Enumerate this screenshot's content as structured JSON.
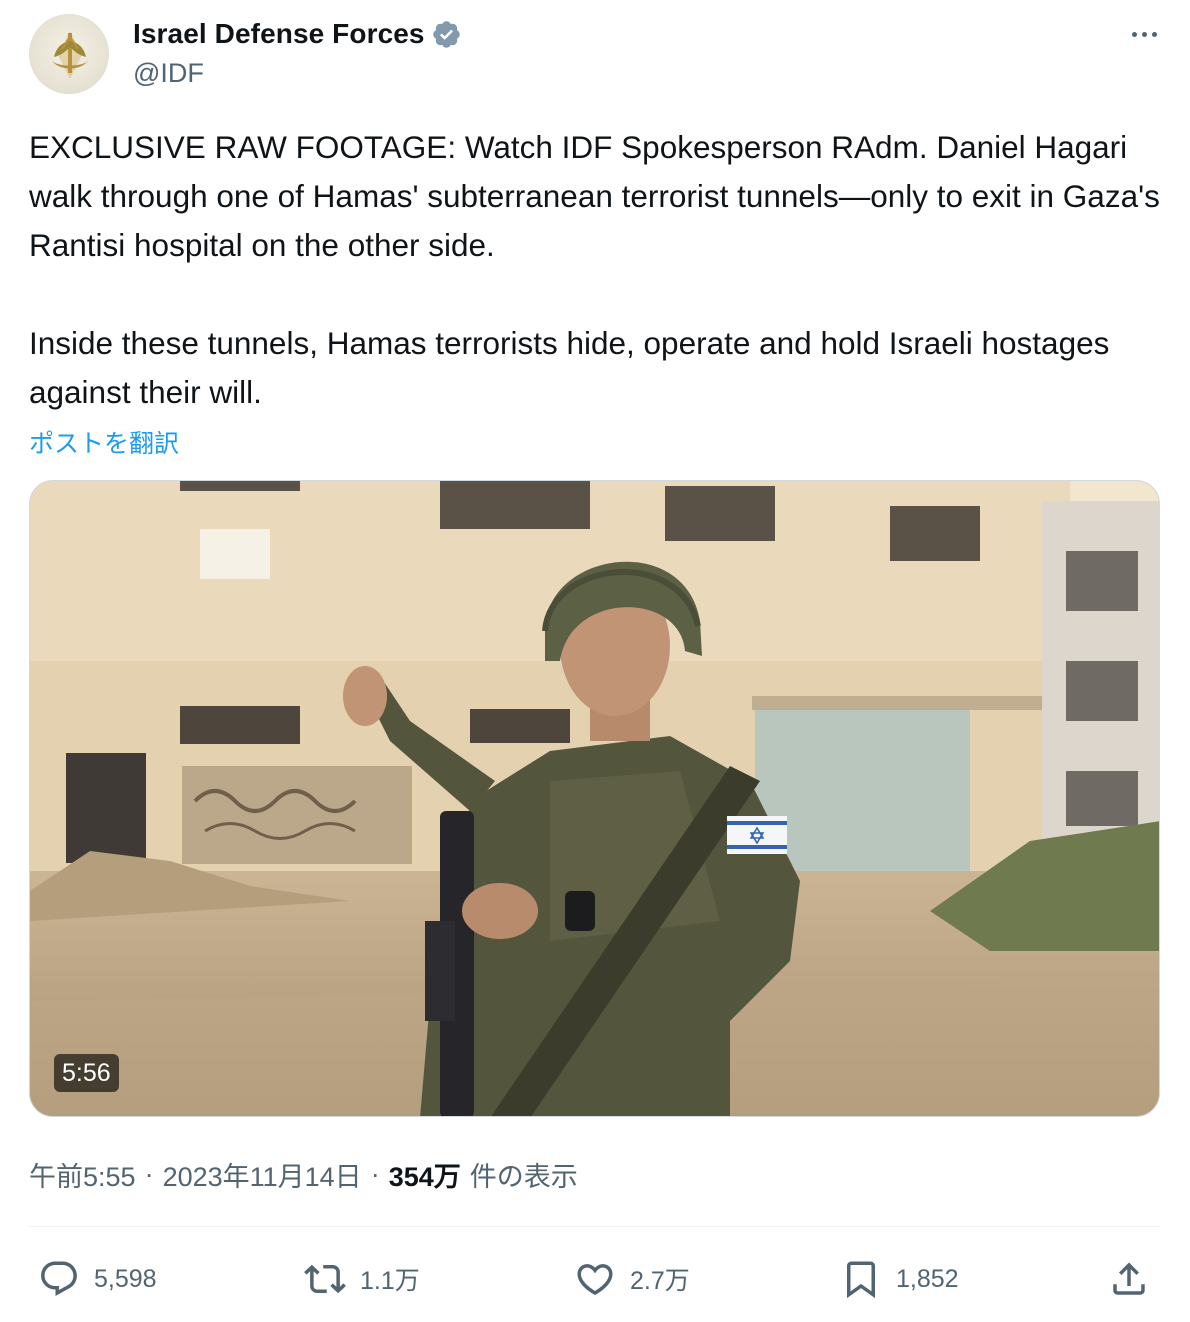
{
  "author": {
    "display_name": "Israel Defense Forces",
    "handle": "@IDF",
    "verified": true,
    "avatar_icon": "idf-emblem-icon"
  },
  "tweet": {
    "paragraph1": "EXCLUSIVE RAW FOOTAGE: Watch IDF Spokesperson RAdm. Daniel Hagari walk through one of Hamas' subterranean terrorist tunnels—only to exit in Gaza's Rantisi hospital on the other side.",
    "paragraph2": "Inside these tunnels, Hamas terrorists hide, operate and hold Israeli hostages against their will.",
    "translate_label": "ポストを翻訳"
  },
  "media": {
    "duration": "5:56"
  },
  "meta": {
    "time": "午前5:55",
    "separator": "·",
    "date": "2023年11月14日",
    "views_count": "354万",
    "views_label": "件の表示"
  },
  "actions": {
    "replies": "5,598",
    "reposts": "1.1万",
    "likes": "2.7万",
    "bookmarks": "1,852"
  },
  "colors": {
    "text": "#0f1419",
    "secondary": "#536471",
    "link": "#1d9bf0",
    "divider": "#eff3f4"
  }
}
